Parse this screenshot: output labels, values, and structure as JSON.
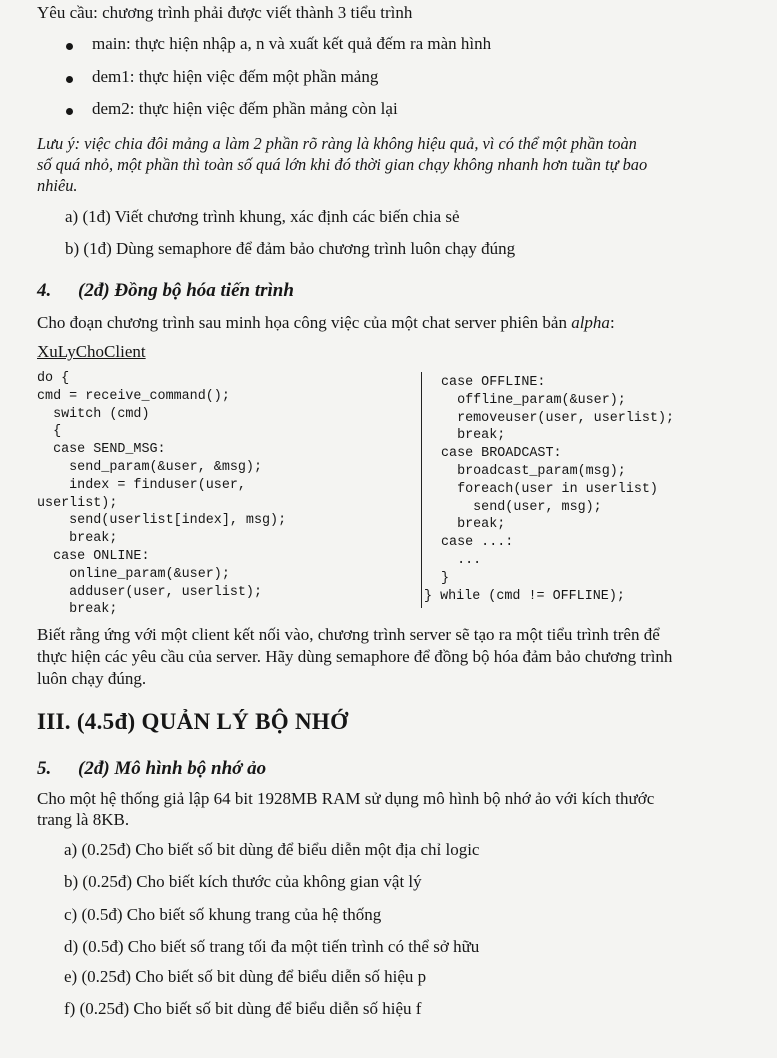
{
  "requirement": "Yêu cầu: chương trình phải được viết thành 3 tiểu trình",
  "bullets": [
    "main: thực hiện nhập a, n và xuất kết quả đếm ra màn hình",
    "dem1: thực hiện việc đếm một phần mảng",
    "dem2: thực hiện việc đếm phần mảng còn lại"
  ],
  "note": [
    "Lưu ý: việc chia đôi mảng a làm 2 phần rõ ràng là không hiệu quả, vì có thể một phần toàn",
    "số quá nhỏ, một phần thì toàn số quá lớn khi đó thời gian chạy không nhanh hơn tuần tự bao",
    "nhiêu."
  ],
  "q3_items": [
    "a)  (1đ) Viết chương trình khung, xác định các biến chia sẻ",
    "b)  (1đ) Dùng semaphore để đảm bảo chương trình luôn chạy đúng"
  ],
  "q4": {
    "number": "4.",
    "title": "(2đ) Đồng bộ hóa tiến trình"
  },
  "q4_intro_prefix": "Cho đoạn chương trình sau minh họa công việc của một chat server phiên bản ",
  "q4_intro_italic": "alpha",
  "q4_intro_suffix": ":",
  "func_name": "XuLyChoClient",
  "code_left": [
    "do {",
    "cmd = receive_command();",
    "  switch (cmd)",
    "  {",
    "  case SEND_MSG:",
    "    send_param(&user, &msg);",
    "    index = finduser(user,",
    "userlist);",
    "    send(userlist[index], msg);",
    "    break;",
    "  case ONLINE:",
    "    online_param(&user);",
    "    adduser(user, userlist);",
    "    break;"
  ],
  "code_right": [
    "case OFFLINE:",
    "  offline_param(&user);",
    "  removeuser(user, userlist);",
    "  break;",
    "case BROADCAST:",
    "  broadcast_param(msg);",
    "  foreach(user in userlist)",
    "    send(user, msg);",
    "  break;",
    "case ...:",
    "  ...",
    "}",
    "} while (cmd != OFFLINE);"
  ],
  "q4_body": [
    "Biết rằng ứng với một client kết nối vào, chương trình server sẽ tạo ra một tiểu trình trên để",
    "thực hiện các yêu cầu của server. Hãy dùng semaphore để đồng bộ hóa đảm bảo chương trình",
    "luôn chạy đúng."
  ],
  "section3": "III.  (4.5đ) QUẢN LÝ BỘ NHỚ",
  "q5": {
    "number": "5.",
    "title": "(2đ) Mô hình bộ nhớ ảo"
  },
  "q5_intro": [
    "Cho một hệ thống giả lập 64 bit 1928MB RAM sử dụng mô hình bộ nhớ ảo với kích thước",
    "trang là 8KB."
  ],
  "q5_items": [
    "a)  (0.25đ) Cho biết số bit dùng để biểu diễn một địa chỉ logic",
    "b)  (0.25đ) Cho biết kích thước của không gian vật lý",
    "c)  (0.5đ) Cho biết số khung trang của hệ thống",
    "d)  (0.5đ) Cho biết số trang tối đa một tiến trình có thể sở hữu",
    "e)  (0.25đ) Cho biết số bit dùng để biểu diễn số hiệu p",
    "f)  (0.25đ) Cho biết số bit dùng để biểu diễn số hiệu f"
  ]
}
